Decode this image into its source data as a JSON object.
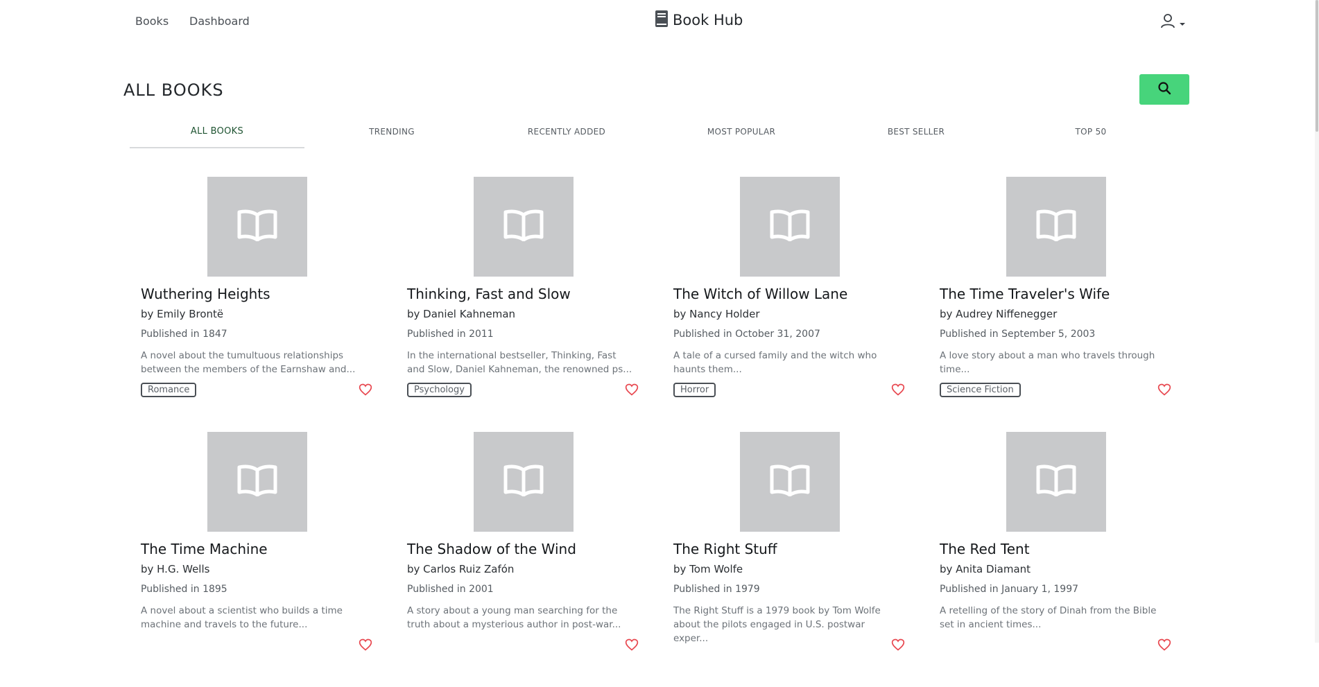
{
  "nav": {
    "links": [
      "Books",
      "Dashboard"
    ],
    "brand": "Book Hub",
    "brand_icon": "book-icon",
    "user_icon": "user-icon"
  },
  "page": {
    "title": "ALL BOOKS",
    "search_icon": "search-icon",
    "search_button_color": "#47d47b"
  },
  "tabs": [
    "ALL BOOKS",
    "TRENDING",
    "RECENTLY ADDED",
    "MOST POPULAR",
    "BEST SELLER",
    "TOP 50"
  ],
  "active_tab": "ALL BOOKS",
  "books": [
    {
      "title": "Wuthering Heights",
      "author": "by Emily Brontë",
      "published": "Published in 1847",
      "description": "A novel about the tumultuous relationships between the members of the Earnshaw and...",
      "genre": "Romance"
    },
    {
      "title": "Thinking, Fast and Slow",
      "author": "by Daniel Kahneman",
      "published": "Published in 2011",
      "description": "In the international bestseller, Thinking, Fast and Slow, Daniel Kahneman, the renowned ps...",
      "genre": "Psychology"
    },
    {
      "title": "The Witch of Willow Lane",
      "author": "by Nancy Holder",
      "published": "Published in October 31, 2007",
      "description": "A tale of a cursed family and the witch who haunts them...",
      "genre": "Horror"
    },
    {
      "title": "The Time Traveler's Wife",
      "author": "by Audrey Niffenegger",
      "published": "Published in September 5, 2003",
      "description": "A love story about a man who travels through time...",
      "genre": "Science Fiction"
    },
    {
      "title": "The Time Machine",
      "author": "by H.G. Wells",
      "published": "Published in 1895",
      "description": "A novel about a scientist who builds a time machine and travels to the future...",
      "genre": ""
    },
    {
      "title": "The Shadow of the Wind",
      "author": "by Carlos Ruiz Zafón",
      "published": "Published in 2001",
      "description": "A story about a young man searching for the truth about a mysterious author in post-war...",
      "genre": ""
    },
    {
      "title": "The Right Stuff",
      "author": "by Tom Wolfe",
      "published": "Published in 1979",
      "description": "The Right Stuff is a 1979 book by Tom Wolfe about the pilots engaged in U.S. postwar exper...",
      "genre": ""
    },
    {
      "title": "The Red Tent",
      "author": "by Anita Diamant",
      "published": "Published in January 1, 1997",
      "description": "A retelling of the story of Dinah from the Bible set in ancient times...",
      "genre": ""
    }
  ],
  "colors": {
    "heart": "#e8474f",
    "cover_placeholder": "#c8c9cb",
    "active_tab_text": "#1f5432"
  }
}
